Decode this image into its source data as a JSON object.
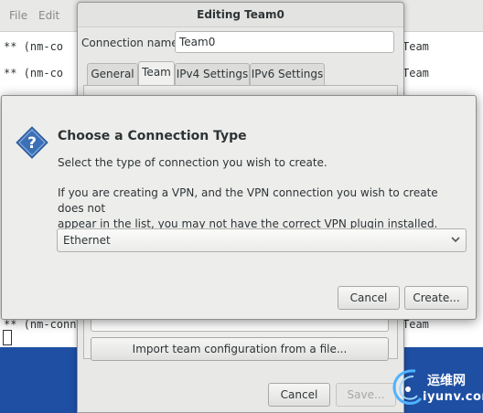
{
  "terminal": {
    "menu": [
      "File",
      "Edit"
    ],
    "lines": [
      {
        "prefix": "** (nm-co",
        "suffix": "Team"
      },
      {
        "prefix": "** (nm-co",
        "suffix": "Team"
      },
      {
        "prefix": "** (nm-conn",
        "suffix": "Team"
      }
    ]
  },
  "editor": {
    "title": "Editing Team0",
    "connection_name_label": "Connection name:",
    "connection_name_value": "Team0",
    "tabs": [
      "General",
      "Team",
      "IPv4 Settings",
      "IPv6 Settings"
    ],
    "active_tab": "Team",
    "import_button": "Import team configuration from a file...",
    "cancel_button": "Cancel",
    "save_button": "Save..."
  },
  "dialog": {
    "heading": "Choose a Connection Type",
    "subtitle": "Select the type of connection you wish to create.",
    "body_line1": "If you are creating a VPN, and the VPN connection you wish to create does not",
    "body_line2": "appear in the list, you may not have the correct VPN plugin installed.",
    "connection_type_selected": "Ethernet",
    "cancel_button": "Cancel",
    "create_button": "Create...",
    "icon": "question-icon"
  },
  "watermark": {
    "chinese": "运维网",
    "url": "iyunv.com"
  },
  "colors": {
    "desktop": "#1e4fa3",
    "window_bg": "#ededec",
    "question_icon": "#3b6fb6"
  }
}
